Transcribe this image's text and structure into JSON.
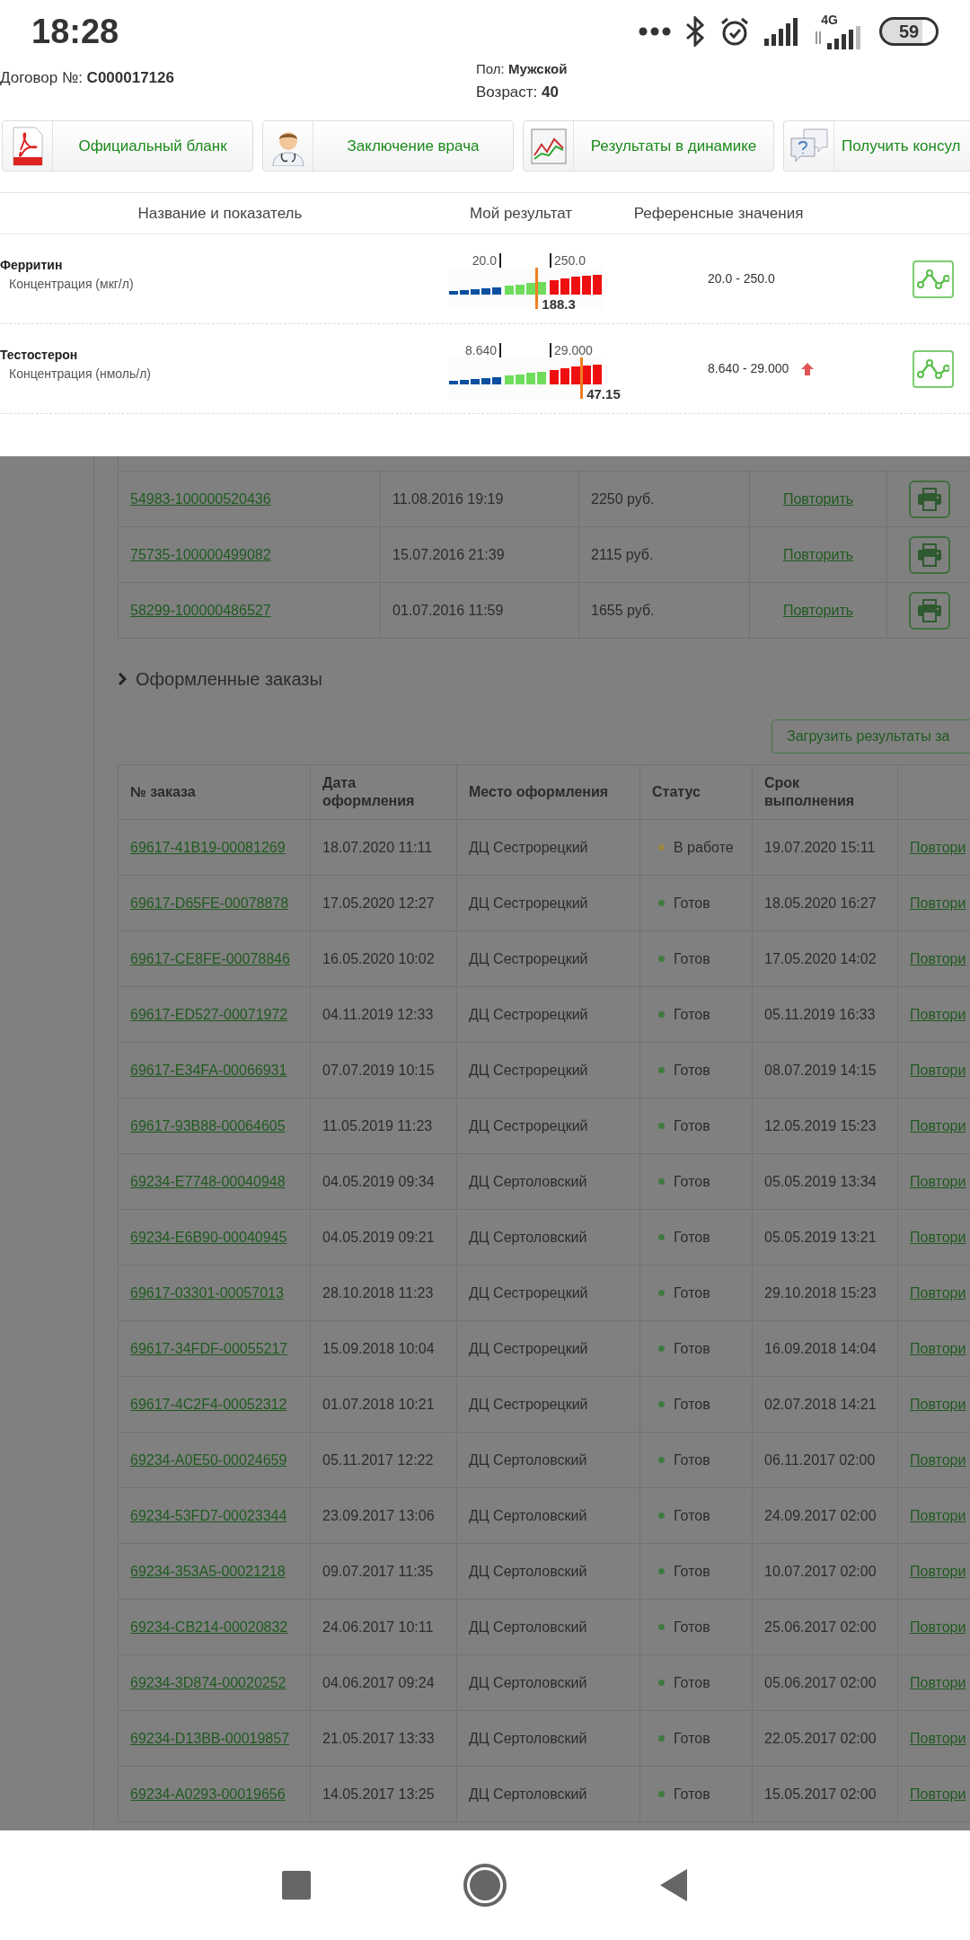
{
  "status_bar": {
    "time": "18:28",
    "network": "4G",
    "battery": "59"
  },
  "patient": {
    "contract_label": "Договор №:",
    "contract_value": "C000017126",
    "sex_label": "Пол:",
    "sex_value": "Мужской",
    "age_label": "Возраст:",
    "age_value": "40"
  },
  "actions": [
    {
      "kind": "pdf",
      "label": "Официальный бланк"
    },
    {
      "kind": "doctor",
      "label": "Заключение врача"
    },
    {
      "kind": "chart",
      "label": "Результаты в динамике"
    },
    {
      "kind": "chat",
      "label": "Получить консул"
    }
  ],
  "results": {
    "columns": [
      "Название и показатель",
      "Мой результат",
      "Референсные значения"
    ],
    "rows": [
      {
        "name": "Ферритин",
        "unit": "Концентрация (мкг/л)",
        "low": "20.0",
        "high": "250.0",
        "value": "188.3",
        "level": 0.56,
        "reference": "20.0 - 250.0",
        "above": false
      },
      {
        "name": "Тестостерон",
        "unit": "Концентрация (нмоль/л)",
        "low": "8.640",
        "high": "29.000",
        "value": "47.15",
        "level": 0.85,
        "reference": "8.640 - 29.000",
        "above": true
      }
    ]
  },
  "previous_orders": [
    {
      "number": "54983-100000520436",
      "date": "11.08.2016 19:19",
      "sum": "2250 руб.",
      "action": "Повторить"
    },
    {
      "number": "75735-100000499082",
      "date": "15.07.2016 21:39",
      "sum": "2115 руб.",
      "action": "Повторить"
    },
    {
      "number": "58299-100000486527",
      "date": "01.07.2016 11:59",
      "sum": "1655 руб.",
      "action": "Повторить"
    }
  ],
  "section_title": "Оформленные заказы",
  "upload_button": "Загрузить результаты за",
  "orders": {
    "columns": [
      "№ заказа",
      "Дата оформления",
      "Место оформления",
      "Статус",
      "Срок выполнения"
    ],
    "rows": [
      {
        "number": "69617-41B19-00081269",
        "date": "18.07.2020 11:11",
        "place": "ДЦ Сестрорецкий",
        "status": "В работе",
        "color": "#9a8840",
        "due": "19.07.2020 15:11",
        "action": "Повтори"
      },
      {
        "number": "69617-D65FE-00078878",
        "date": "17.05.2020 12:27",
        "place": "ДЦ Сестрорецкий",
        "status": "Готов",
        "color": "#3f7a3f",
        "due": "18.05.2020 16:27",
        "action": "Повтори"
      },
      {
        "number": "69617-CE8FE-00078846",
        "date": "16.05.2020 10:02",
        "place": "ДЦ Сестрорецкий",
        "status": "Готов",
        "color": "#3f7a3f",
        "due": "17.05.2020 14:02",
        "action": "Повтори"
      },
      {
        "number": "69617-ED527-00071972",
        "date": "04.11.2019 12:33",
        "place": "ДЦ Сестрорецкий",
        "status": "Готов",
        "color": "#3f7a3f",
        "due": "05.11.2019 16:33",
        "action": "Повтори"
      },
      {
        "number": "69617-E34FA-00066931",
        "date": "07.07.2019 10:15",
        "place": "ДЦ Сестрорецкий",
        "status": "Готов",
        "color": "#3f7a3f",
        "due": "08.07.2019 14:15",
        "action": "Повтори"
      },
      {
        "number": "69617-93B88-00064605",
        "date": "11.05.2019 11:23",
        "place": "ДЦ Сестрорецкий",
        "status": "Готов",
        "color": "#3f7a3f",
        "due": "12.05.2019 15:23",
        "action": "Повтори"
      },
      {
        "number": "69234-E7748-00040948",
        "date": "04.05.2019 09:34",
        "place": "ДЦ Сертоловский",
        "status": "Готов",
        "color": "#3f7a3f",
        "due": "05.05.2019 13:34",
        "action": "Повтори"
      },
      {
        "number": "69234-E6B90-00040945",
        "date": "04.05.2019 09:21",
        "place": "ДЦ Сертоловский",
        "status": "Готов",
        "color": "#3f7a3f",
        "due": "05.05.2019 13:21",
        "action": "Повтори"
      },
      {
        "number": "69617-03301-00057013",
        "date": "28.10.2018 11:23",
        "place": "ДЦ Сестрорецкий",
        "status": "Готов",
        "color": "#3f7a3f",
        "due": "29.10.2018 15:23",
        "action": "Повтори"
      },
      {
        "number": "69617-34FDF-00055217",
        "date": "15.09.2018 10:04",
        "place": "ДЦ Сестрорецкий",
        "status": "Готов",
        "color": "#3f7a3f",
        "due": "16.09.2018 14:04",
        "action": "Повтори"
      },
      {
        "number": "69617-4C2F4-00052312",
        "date": "01.07.2018 10:21",
        "place": "ДЦ Сестрорецкий",
        "status": "Готов",
        "color": "#3f7a3f",
        "due": "02.07.2018 14:21",
        "action": "Повтори"
      },
      {
        "number": "69234-A0E50-00024659",
        "date": "05.11.2017 12:22",
        "place": "ДЦ Сертоловский",
        "status": "Готов",
        "color": "#3f7a3f",
        "due": "06.11.2017 02:00",
        "action": "Повтори"
      },
      {
        "number": "69234-53FD7-00023344",
        "date": "23.09.2017 13:06",
        "place": "ДЦ Сертоловский",
        "status": "Готов",
        "color": "#3f7a3f",
        "due": "24.09.2017 02:00",
        "action": "Повтори"
      },
      {
        "number": "69234-353A5-00021218",
        "date": "09.07.2017 11:35",
        "place": "ДЦ Сертоловский",
        "status": "Готов",
        "color": "#3f7a3f",
        "due": "10.07.2017 02:00",
        "action": "Повтори"
      },
      {
        "number": "69234-CB214-00020832",
        "date": "24.06.2017 10:11",
        "place": "ДЦ Сертоловский",
        "status": "Готов",
        "color": "#3f7a3f",
        "due": "25.06.2017 02:00",
        "action": "Повтори"
      },
      {
        "number": "69234-3D874-00020252",
        "date": "04.06.2017 09:24",
        "place": "ДЦ Сертоловский",
        "status": "Готов",
        "color": "#3f7a3f",
        "due": "05.06.2017 02:00",
        "action": "Повтори"
      },
      {
        "number": "69234-D13BB-00019857",
        "date": "21.05.2017 13:33",
        "place": "ДЦ Сертоловский",
        "status": "Готов",
        "color": "#3f7a3f",
        "due": "22.05.2017 02:00",
        "action": "Повтори"
      },
      {
        "number": "69234-A0293-00019656",
        "date": "14.05.2017 13:25",
        "place": "ДЦ Сертоловский",
        "status": "Готов",
        "color": "#3f7a3f",
        "due": "15.05.2017 02:00",
        "action": "Повтори"
      }
    ]
  }
}
